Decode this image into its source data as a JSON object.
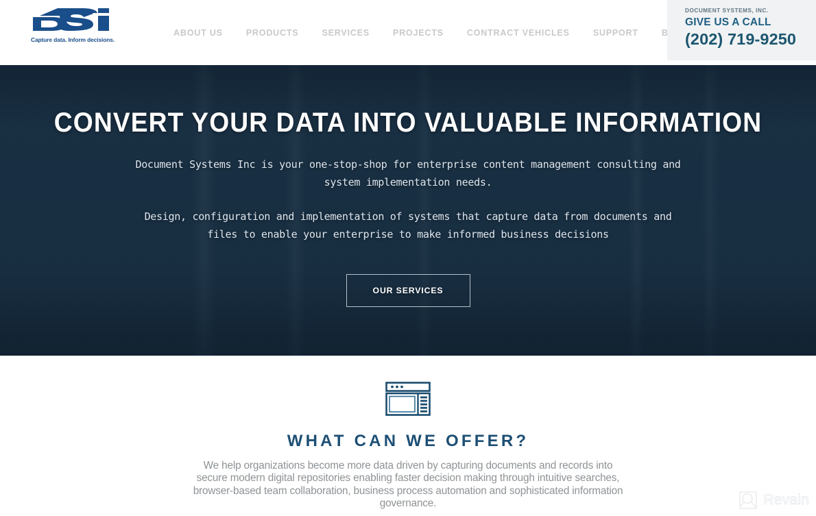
{
  "header": {
    "logo": {
      "name": "DSI",
      "letters": "DSI",
      "tagline": "Capture data. Inform decisions.",
      "color": "#1a4e8a"
    },
    "nav": [
      {
        "label": "ABOUT US",
        "name": "about-us"
      },
      {
        "label": "PRODUCTS",
        "name": "products"
      },
      {
        "label": "SERVICES",
        "name": "services"
      },
      {
        "label": "PROJECTS",
        "name": "projects"
      },
      {
        "label": "CONTRACT VEHICLES",
        "name": "contract-vehicles"
      },
      {
        "label": "SUPPORT",
        "name": "support"
      },
      {
        "label": "BLOG",
        "name": "blog"
      }
    ],
    "contact": {
      "company": "DOCUMENT SYSTEMS, INC.",
      "call_label": "GIVE US A CALL",
      "phone": "(202) 719-9250",
      "background": "#f0f2f4",
      "accent": "#1c566f"
    }
  },
  "hero": {
    "title": "CONVERT YOUR DATA INTO VALUABLE INFORMATION",
    "paragraph1": "Document Systems Inc is your one-stop-shop for enterprise content management consulting and system implementation needs.",
    "paragraph2": "Design, configuration and implementation of systems that capture data from documents and files to enable your enterprise to make informed business decisions",
    "button_label": "OUR SERVICES",
    "background_color": "#1a3145"
  },
  "offer": {
    "icon_name": "window-layout-icon",
    "icon_color": "#1d4e6f",
    "title": "WHAT CAN WE OFFER?",
    "body": "We help organizations become more data driven by capturing documents and records into secure modern digital repositories enabling faster decision making through intuitive searches, browser-based team collaboration, business process automation and sophisticated information governance.",
    "title_color": "#1d4f74"
  },
  "watermark": {
    "label": "Revain",
    "icon_name": "revain-magnifier-logo"
  }
}
